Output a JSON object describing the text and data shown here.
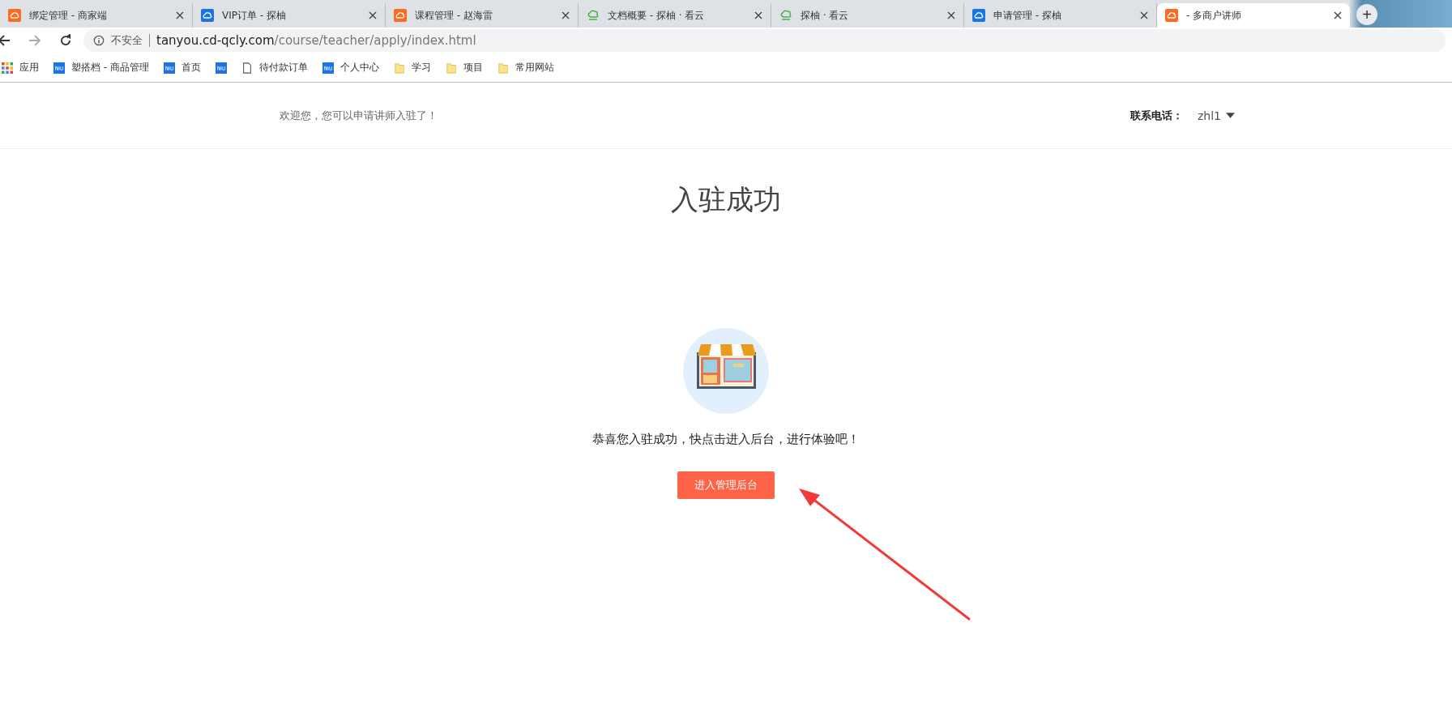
{
  "tabs": [
    {
      "title": "绑定管理 - 商家端",
      "kind": "merchant",
      "selected": false
    },
    {
      "title": "VIP订单 - 探柚",
      "kind": "niu",
      "selected": false
    },
    {
      "title": "课程管理 - 赵海雷",
      "kind": "merchant",
      "selected": false
    },
    {
      "title": "文档概要 - 探柚 · 看云",
      "kind": "docs",
      "selected": false
    },
    {
      "title": "探柚 · 看云",
      "kind": "docs",
      "selected": false
    },
    {
      "title": "申请管理 - 探柚",
      "kind": "niu",
      "selected": false
    },
    {
      "title": "- 多商户讲师",
      "kind": "merchant",
      "selected": true
    }
  ],
  "new_tab": "+",
  "address": {
    "security": "不安全",
    "host": "tanyou.cd-qcly.com",
    "path": "/course/teacher/apply/index.html"
  },
  "bookmarks": [
    {
      "label": "应用",
      "kind": "apps"
    },
    {
      "label": "塑搭档 - 商品管理",
      "kind": "niu"
    },
    {
      "label": "首页",
      "kind": "niu"
    },
    {
      "kind": "niu"
    },
    {
      "label": "待付款订单",
      "kind": "page"
    },
    {
      "label": "个人中心",
      "kind": "niu"
    },
    {
      "label": "学习",
      "kind": "folder"
    },
    {
      "label": "项目",
      "kind": "folder"
    },
    {
      "label": "常用网站",
      "kind": "folder"
    }
  ],
  "header": {
    "welcome": "欢迎您，您可以申请讲师入驻了！",
    "phone_label": "联系电话：",
    "user": "zhl1"
  },
  "main": {
    "title": "入驻成功",
    "message": "恭喜您入驻成功，快点击进入后台，进行体验吧！",
    "button": "进入管理后台"
  }
}
